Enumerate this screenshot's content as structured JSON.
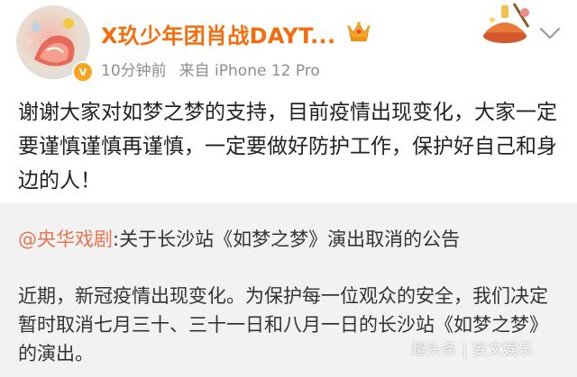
{
  "post": {
    "username": "X玖少年团肖战DAYT...",
    "time": "10分钟前",
    "source": "来自 iPhone 12 Pro",
    "text": "谢谢大家对如梦之梦的支持，目前疫情出现变化，大家一定要谨慎谨慎再谨慎，一定要做好防护工作，保护好自己和身边的人！"
  },
  "repost": {
    "mention": "@央华戏剧",
    "title_rest": ":关于长沙站《如梦之梦》演出取消的公告",
    "body": "近期，新冠疫情出现变化。为保护每一位观众的安全，我们决定暂时取消七月三十、三十一日和八月一日的长沙站《如梦之梦》的演出。"
  },
  "watermark": "趣头条 | 妄文娱乐",
  "icons": {
    "avatar": "avatar-illustration",
    "verified": "verified-badge-icon",
    "vip": "crown-icon",
    "sticker": "sticker-icon",
    "more": "chevron-down-icon"
  },
  "colors": {
    "username": "#f56c0c",
    "mention": "#eb7350",
    "meta": "#8e8e8e",
    "repost_bg": "#f2f2f2"
  }
}
